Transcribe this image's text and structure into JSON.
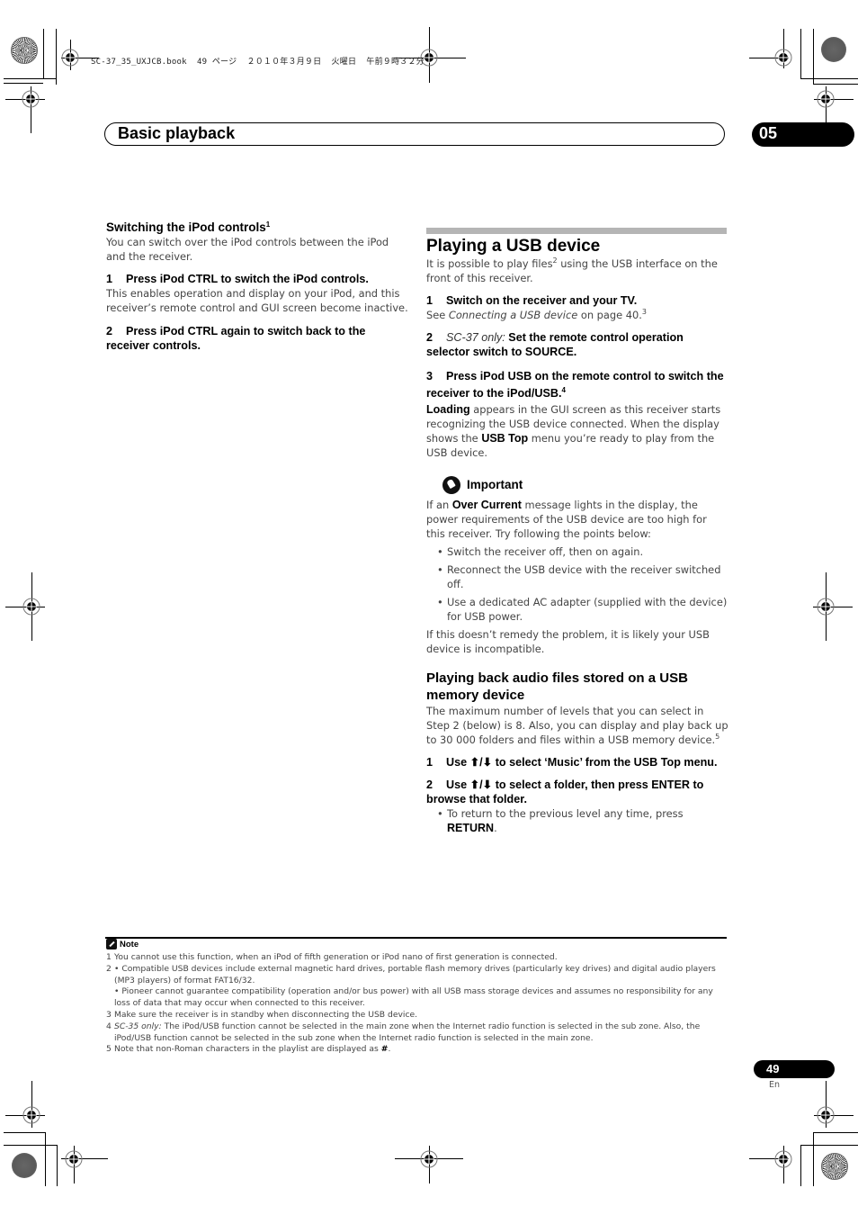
{
  "file_header": "SC-37_35_UXJCB.book  49 ページ  ２０１０年３月９日  火曜日  午前９時３２分",
  "chapter": {
    "title": "Basic playback",
    "number": "05"
  },
  "left_column": {
    "heading": "Switching the iPod controls",
    "heading_note": "1",
    "intro": "You can switch over the iPod controls between the iPod and the receiver.",
    "steps": [
      {
        "number": "1",
        "title": "Press iPod CTRL to switch the iPod controls.",
        "body": "This enables operation and display on your iPod, and this receiver’s remote control and GUI screen become inactive."
      },
      {
        "number": "2",
        "title": "Press iPod CTRL again to switch back to the receiver controls."
      }
    ]
  },
  "right_column": {
    "section_title": "Playing a USB device",
    "intro_before": "It is possible to play files",
    "intro_note": "2",
    "intro_after": " using the USB interface on the front of this receiver.",
    "step1": {
      "number": "1",
      "title": "Switch on the receiver and your TV.",
      "body_prefix": "See ",
      "body_link": "Connecting a USB device",
      "body_suffix": " on page 40.",
      "note": "3"
    },
    "step2": {
      "number": "2",
      "qualifier": "SC-37 only:",
      "title": " Set the remote control operation selector switch to SOURCE."
    },
    "step3": {
      "number": "3",
      "title": "Press iPod USB on the remote control to switch the receiver to the iPod/USB.",
      "note": "4",
      "body_bold1": "Loading",
      "body_text1": " appears in the GUI screen as this receiver starts recognizing the USB device connected. When the display shows the ",
      "body_bold2": "USB Top",
      "body_text2": " menu you’re ready to play from the USB device."
    },
    "important": {
      "label": "Important",
      "text_prefix": "If an ",
      "text_bold": "Over Current",
      "text_suffix": " message lights in the display, the power requirements of the USB device are too high for this receiver. Try following the points below:",
      "bullets": [
        "Switch the receiver off, then on again.",
        "Reconnect the USB device with the receiver switched off.",
        "Use a dedicated AC adapter (supplied with the device) for USB power."
      ],
      "closing": "If this doesn’t remedy the problem, it is likely your USB device is incompatible."
    },
    "subsection": {
      "title": "Playing back audio files stored on a USB memory device",
      "intro": "The maximum number of levels that you can select in Step 2 (below) is 8. Also, you can display and play back up to 30 000 folders and files within a USB memory device.",
      "intro_note": "5",
      "steps": [
        {
          "number": "1",
          "prefix": "Use ",
          "arrows": "⬆/⬇",
          "title": " to select ‘Music’ from the USB Top menu."
        },
        {
          "number": "2",
          "prefix": "Use ",
          "arrows": "⬆/⬇",
          "title": " to select a folder, then press ENTER to browse that folder."
        }
      ],
      "bullet_prefix": "To return to the previous level any time, press ",
      "bullet_bold": "RETURN",
      "bullet_suffix": "."
    }
  },
  "notes": {
    "label": "Note",
    "items": [
      {
        "n": "1",
        "text": "You cannot use this function, when an iPod of fifth generation or iPod nano of first generation is connected."
      },
      {
        "n": "2",
        "text": "• Compatible USB devices include external magnetic hard drives, portable flash memory drives (particularly key drives) and digital audio players (MP3 players) of format FAT16/32."
      },
      {
        "n": "",
        "text": "• Pioneer cannot guarantee compatibility (operation and/or bus power) with all USB mass storage devices and assumes no responsibility for any loss of data that may occur when connected to this receiver."
      },
      {
        "n": "3",
        "text": "Make sure the receiver is in standby when disconnecting the USB device."
      },
      {
        "n": "4",
        "qualifier": "SC-35 only:",
        "text": " The iPod/USB function cannot be selected in the main zone when the Internet radio function is selected in the sub zone. Also, the iPod/USB function cannot be selected in the sub zone when the Internet radio function is selected in the main zone."
      },
      {
        "n": "5",
        "text": "Note that non-Roman characters in the playlist are displayed as ",
        "bold": "#",
        "suffix": "."
      }
    ]
  },
  "footer": {
    "page_number": "49",
    "language": "En"
  }
}
